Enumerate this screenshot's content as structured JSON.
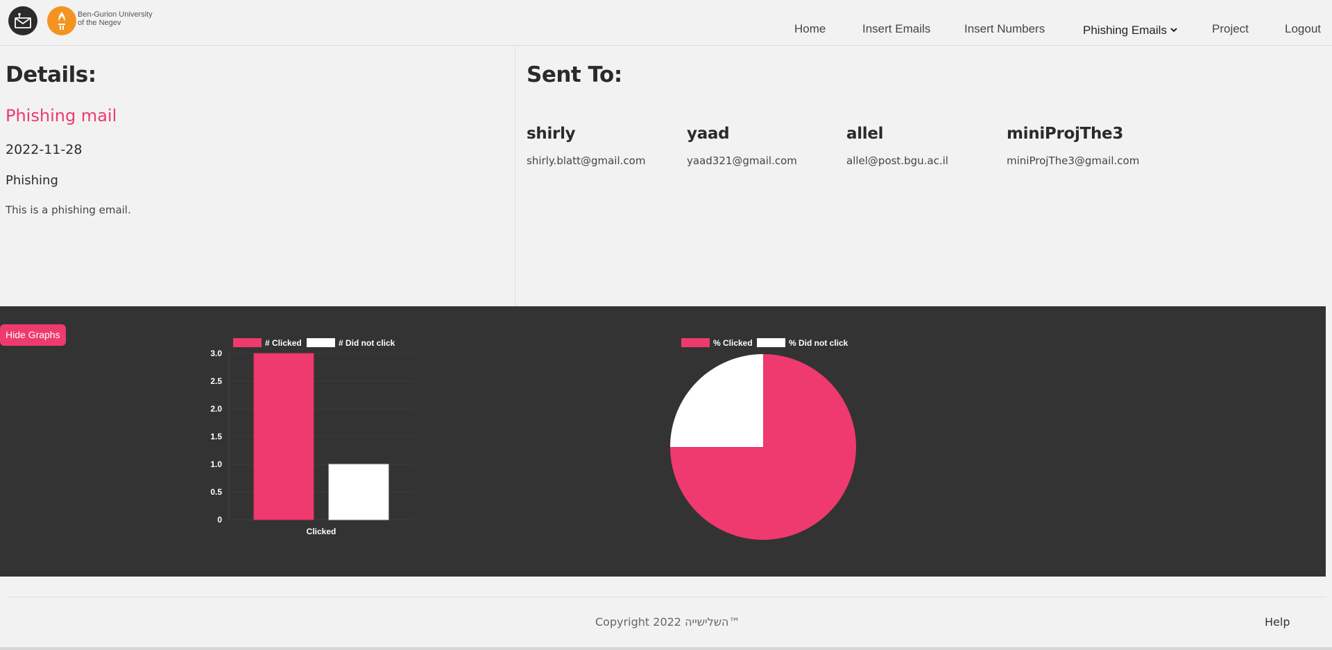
{
  "header": {
    "university_line1": "Ben-Gurion University",
    "university_line2": "of the Negev",
    "nav": [
      {
        "label": "Home"
      },
      {
        "label": "Insert Emails"
      },
      {
        "label": "Insert Numbers"
      },
      {
        "label": "Phishing Emails",
        "dropdown": true
      },
      {
        "label": "Project"
      },
      {
        "label": "Logout"
      }
    ]
  },
  "details": {
    "heading": "Details:",
    "title": "Phishing mail",
    "date": "2022-11-28",
    "type": "Phishing",
    "description": "This is a phishing email."
  },
  "sent_to": {
    "heading": "Sent To:",
    "recipients": [
      {
        "name": "shirly",
        "email": "shirly.blatt@gmail.com"
      },
      {
        "name": "yaad",
        "email": "yaad321@gmail.com"
      },
      {
        "name": "allel",
        "email": "allel@post.bgu.ac.il"
      },
      {
        "name": "miniProjThe3",
        "email": "miniProjThe3@gmail.com"
      }
    ]
  },
  "graphs": {
    "hide_button": "Hide Graphs"
  },
  "chart_data": [
    {
      "type": "bar",
      "categories": [
        "Clicked"
      ],
      "series": [
        {
          "name": "# Clicked",
          "values": [
            3
          ],
          "color": "#ee3a6e"
        },
        {
          "name": "# Did not click",
          "values": [
            1
          ],
          "color": "#ffffff"
        }
      ],
      "yticks": [
        "3.0",
        "2.5",
        "2.0",
        "1.5",
        "1.0",
        "0.5",
        "0"
      ],
      "ylim": [
        0,
        3
      ],
      "legend": "top"
    },
    {
      "type": "pie",
      "labels": [
        "% Clicked",
        "% Did not click"
      ],
      "values": [
        75,
        25
      ],
      "colors": [
        "#ee3a6e",
        "#ffffff"
      ],
      "legend": "top"
    }
  ],
  "footer": {
    "copyright": "Copyright 2022 השלישייה™",
    "help": "Help"
  },
  "colors": {
    "accent": "#ee3a6e",
    "graph_bg": "#333333",
    "page_bg": "#f2f2f2"
  }
}
